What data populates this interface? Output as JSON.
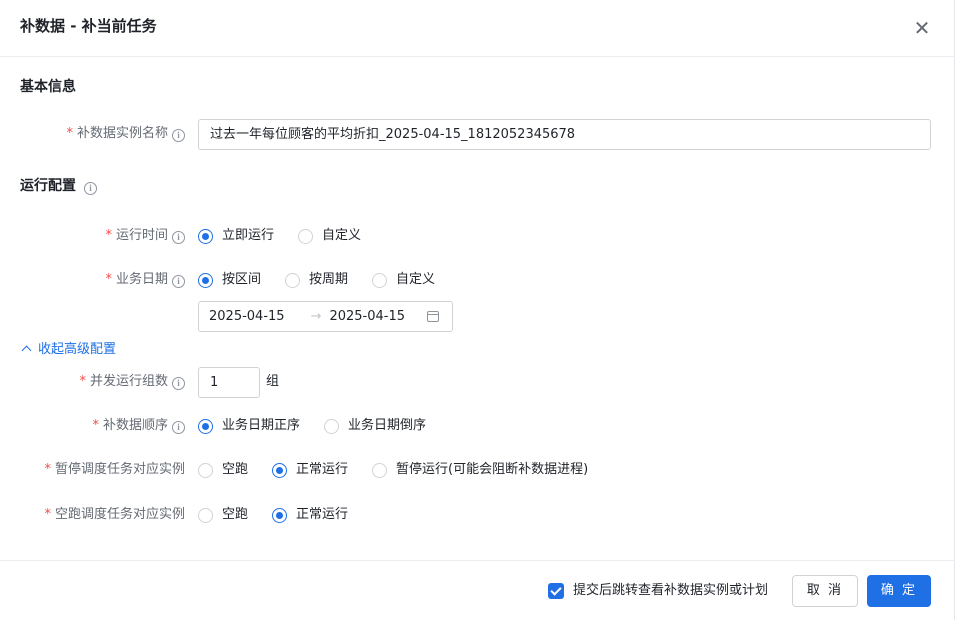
{
  "dialog": {
    "title": "补数据 - 补当前任务",
    "close_icon": "close-icon"
  },
  "basic": {
    "section_title": "基本信息",
    "instance_name_label": "补数据实例名称",
    "instance_name_value": "过去一年每位顾客的平均折扣_2025-04-15_1812052345678"
  },
  "run_config": {
    "section_title": "运行配置",
    "run_time_label": "运行时间",
    "run_time_options": [
      "立即运行",
      "自定义"
    ],
    "run_time_selected": "立即运行",
    "biz_date_label": "业务日期",
    "biz_date_options": [
      "按区间",
      "按周期",
      "自定义"
    ],
    "biz_date_selected": "按区间",
    "date_start": "2025-04-15",
    "date_arrow": "→",
    "date_end": "2025-04-15"
  },
  "advanced": {
    "collapse_label": "收起高级配置",
    "concurrency_label": "并发运行组数",
    "concurrency_value": "1",
    "concurrency_unit": "组",
    "order_label": "补数据顺序",
    "order_options": [
      "业务日期正序",
      "业务日期倒序"
    ],
    "order_selected": "业务日期正序",
    "paused_label": "暂停调度任务对应实例",
    "paused_options": [
      "空跑",
      "正常运行",
      "暂停运行(可能会阻断补数据进程)"
    ],
    "paused_selected": "正常运行",
    "dryrun_label": "空跑调度任务对应实例",
    "dryrun_options": [
      "空跑",
      "正常运行"
    ],
    "dryrun_selected": "正常运行"
  },
  "footer": {
    "checkbox_label": "提交后跳转查看补数据实例或计划",
    "checkbox_checked": true,
    "cancel_label": "取 消",
    "ok_label": "确 定"
  },
  "colors": {
    "primary": "#1f6fe5",
    "required": "#f54a45",
    "border": "#d0d3d6"
  },
  "info_icon": "ⓘ"
}
